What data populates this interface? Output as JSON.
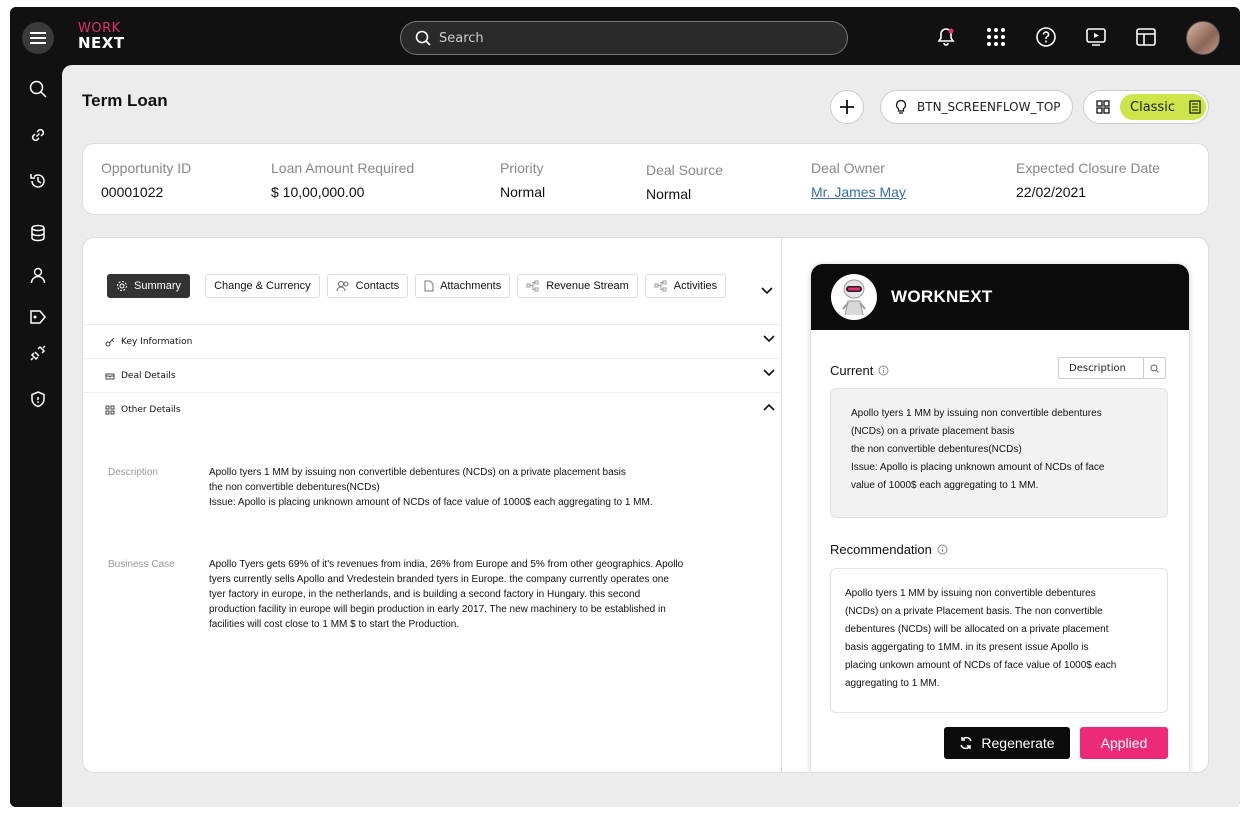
{
  "app": {
    "logo_line1": "WORK",
    "logo_line2": "NEXT"
  },
  "search": {
    "placeholder": "Search"
  },
  "page": {
    "title": "Term Loan"
  },
  "toolbar": {
    "flow_button_label": "BTN_SCREENFLOW_TOP",
    "view_mode_label": "Classic"
  },
  "summary_fields": [
    {
      "label": "Opportunity ID",
      "value": "00001022"
    },
    {
      "label": "Loan Amount Required",
      "value": "$ 10,00,000.00"
    },
    {
      "label": "Priority",
      "value": "Normal"
    },
    {
      "label": "Deal Source",
      "value": "Normal"
    },
    {
      "label": "Deal Owner",
      "value": "Mr. James May"
    },
    {
      "label": "Expected Closure Date",
      "value": "22/02/2021"
    }
  ],
  "tabs": [
    {
      "label": "Summary",
      "icon": "gear-icon"
    },
    {
      "label": "Change & Currency",
      "icon": ""
    },
    {
      "label": "Contacts",
      "icon": "contacts-icon"
    },
    {
      "label": "Attachments",
      "icon": "file-icon"
    },
    {
      "label": "Revenue Stream",
      "icon": "flow-icon"
    },
    {
      "label": "Activities",
      "icon": "flow-icon"
    }
  ],
  "sections": [
    {
      "label": "Key Information",
      "expanded": false
    },
    {
      "label": "Deal Details",
      "expanded": false
    },
    {
      "label": "Other Details",
      "expanded": true
    }
  ],
  "details": {
    "description_label": "Description",
    "description_lines": [
      "Apollo tyers 1 MM by issuing non convertible debentures (NCDs) on a private placement basis",
      "the non convertible debentures(NCDs)",
      "Issue: Apollo is placing unknown amount of NCDs of face value of 1000$ each aggregating to 1 MM."
    ],
    "business_case_label": "Business Case",
    "business_case_lines": [
      "Apollo Tyers gets 69% of it's revenues from india, 26% from Europe and 5% from other geographics. Apollo",
      "tyers currently sells Apollo and Vredestein branded tyers in Europe. the company currently operates one",
      "tyer factory in europe, in the netherlands, and is building a second factory in Hungary. this second",
      "production facility in europe will begin production in early 2017. The new machinery to be established in",
      "facilities will cost close to 1 MM $ to start the Production."
    ]
  },
  "ai_panel": {
    "title": "WORKNEXT",
    "current_label": "Current",
    "description_select": "Description",
    "current_lines": [
      "Apollo tyers 1 MM by issuing non convertible debentures",
      "(NCDs) on a private placement basis",
      "the non convertible debentures(NCDs)",
      "Issue: Apollo is placing unknown amount of NCDs of face",
      "value of 1000$ each aggregating to 1 MM."
    ],
    "recommendation_label": "Recommendation",
    "recommendation_lines": [
      "Apollo tyers 1 MM by issuing non convertible debentures",
      "(NCDs) on a  private Placement basis.  The non convertible",
      "debentures (NCDs) will be allocated on a private placement",
      "basis aggergating to 1MM. in its present issue Apollo is",
      "placing unkown amount of NCDs of face value of 1000$ each",
      "aggregating to 1 MM."
    ],
    "regenerate_label": "Regenerate",
    "applied_label": "Applied"
  },
  "colors": {
    "accent_pink": "#ec2a78",
    "classic_green": "#cfe34a",
    "dark": "#111111"
  }
}
